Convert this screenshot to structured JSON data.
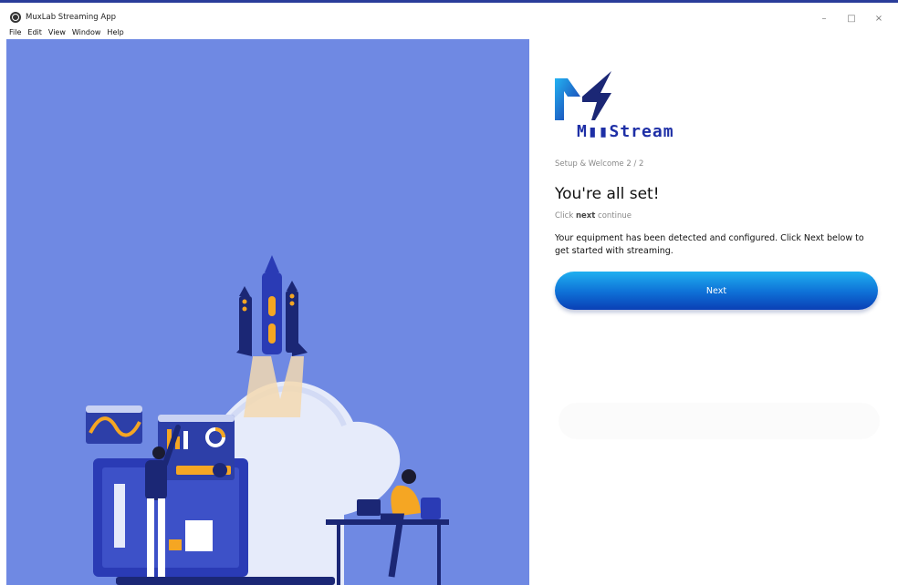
{
  "window": {
    "title": "MuxLab Streaming App",
    "controls": {
      "minimize": "–",
      "maximize": "□",
      "close": "×"
    }
  },
  "menu": [
    "File",
    "Edit",
    "View",
    "Window",
    "Help"
  ],
  "brand": {
    "wordmark": "M▮▮Stream",
    "primary_color": "#1e2fa6"
  },
  "setup": {
    "step_label": "Setup & Welcome 2 / 2",
    "heading": "You're all set!",
    "hint_prefix": "Click",
    "hint_bold": "next",
    "hint_suffix": "continue",
    "description": "Your equipment has been detected and configured. Click Next below to get started with streaming.",
    "next_label": "Next"
  },
  "colors": {
    "hero_background": "#6f89e3",
    "button_gradient": [
      "#1fb0f0",
      "#0e6fd6",
      "#0a3fb5"
    ]
  }
}
